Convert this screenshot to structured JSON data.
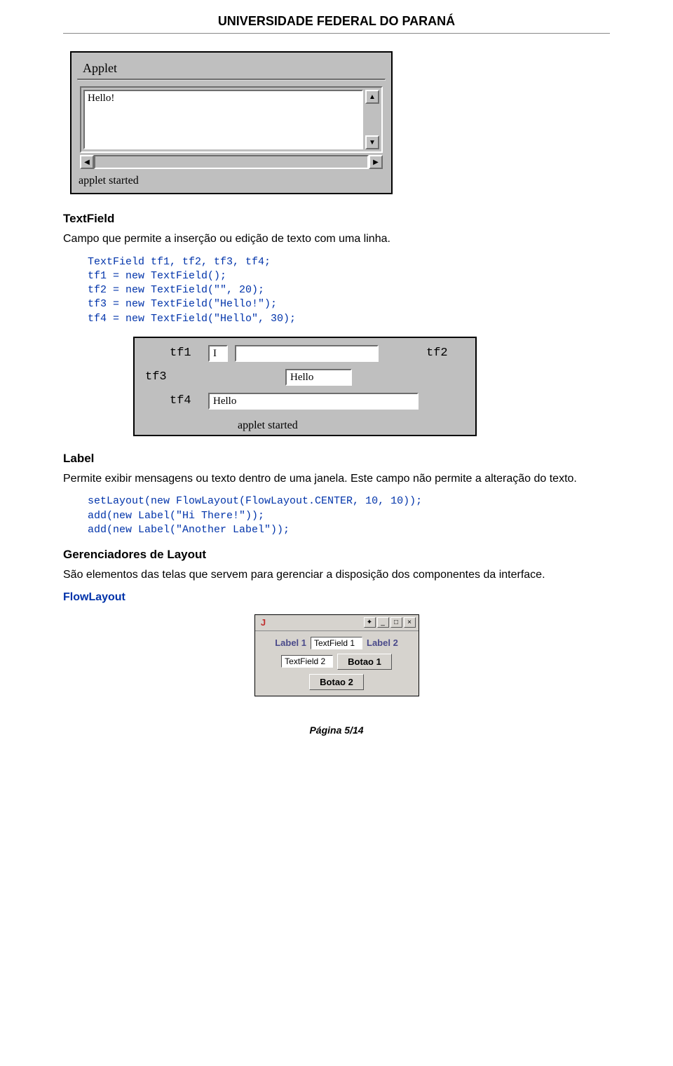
{
  "header": {
    "title": "UNIVERSIDADE FEDERAL DO PARANÁ"
  },
  "applet1": {
    "title": "Applet",
    "textarea_value": "Hello!",
    "status": "applet started"
  },
  "section_textfield": {
    "heading": "TextField",
    "desc": "Campo que permite a inserção ou edição de texto com uma linha.",
    "code": "TextField tf1, tf2, tf3, tf4;\ntf1 = new TextField();\ntf2 = new TextField(\"\", 20);\ntf3 = new TextField(\"Hello!\");\ntf4 = new TextField(\"Hello\", 30);"
  },
  "applet2": {
    "labels": {
      "tf1": "tf1",
      "tf2": "tf2",
      "tf3": "tf3",
      "tf4": "tf4"
    },
    "values": {
      "tf1": "I",
      "tf2": "",
      "tf3": "Hello",
      "tf4": "Hello"
    },
    "status": "applet started"
  },
  "section_label": {
    "heading": "Label",
    "desc": "Permite exibir mensagens ou texto dentro de uma janela. Este campo não permite a alteração do texto.",
    "code": "setLayout(new FlowLayout(FlowLayout.CENTER, 10, 10));\nadd(new Label(\"Hi There!\"));\nadd(new Label(\"Another Label\"));"
  },
  "section_layout": {
    "heading": "Gerenciadores de Layout",
    "desc": "São elementos das telas que servem para gerenciar a disposição dos componentes da interface.",
    "sub": "FlowLayout"
  },
  "applet3": {
    "java_icon": "J",
    "pin": "✦",
    "min": "_",
    "max": "□",
    "close": "×",
    "label1": "Label 1",
    "label2": "Label 2",
    "tf1": "TextField 1",
    "tf2": "TextField 2",
    "btn1": "Botao 1",
    "btn2": "Botao 2"
  },
  "footer": {
    "page": "Página 5/14"
  }
}
